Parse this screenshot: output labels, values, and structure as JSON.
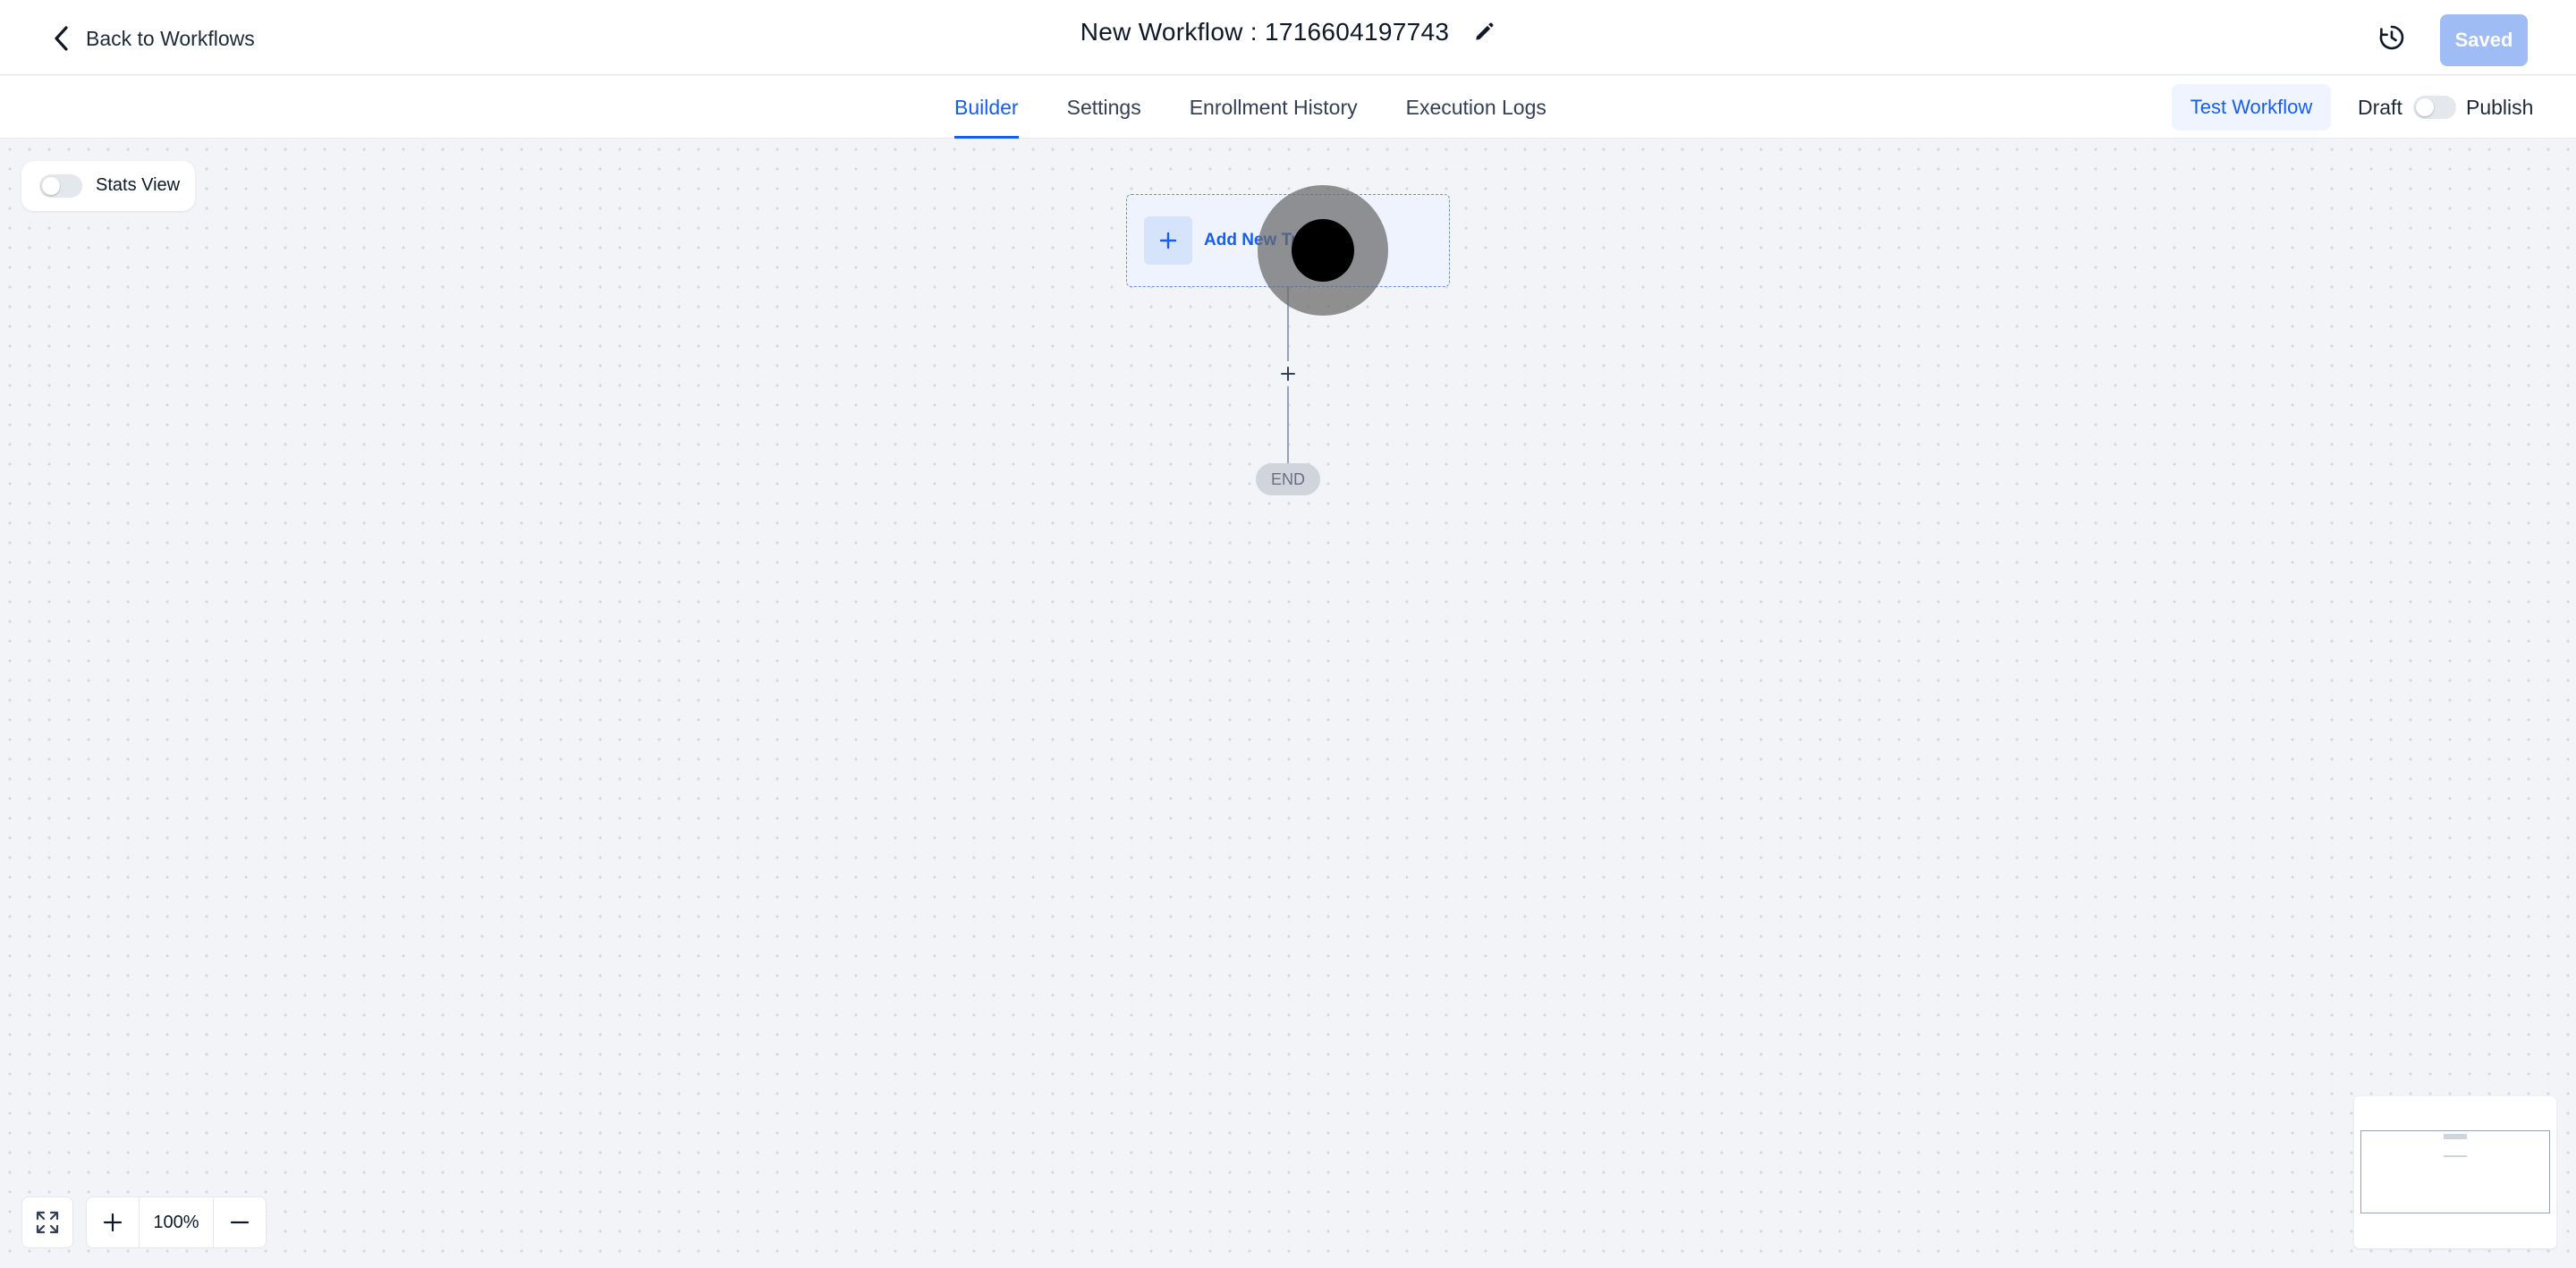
{
  "header": {
    "back_label": "Back to Workflows",
    "title": "New Workflow : 1716604197743",
    "saved_label": "Saved"
  },
  "tabs": [
    {
      "label": "Builder",
      "active": true
    },
    {
      "label": "Settings",
      "active": false
    },
    {
      "label": "Enrollment History",
      "active": false
    },
    {
      "label": "Execution Logs",
      "active": false
    }
  ],
  "actions": {
    "test_label": "Test Workflow",
    "draft_label": "Draft",
    "publish_label": "Publish",
    "published": false
  },
  "canvas": {
    "stats_view_label": "Stats View",
    "stats_view_on": false,
    "trigger_label": "Add New Trigger",
    "end_label": "END"
  },
  "zoom": {
    "level": "100%"
  },
  "icons": {
    "back": "chevron-left-icon",
    "edit": "pencil-icon",
    "history": "history-icon",
    "add": "plus-icon",
    "fit": "expand-icon",
    "zoom_in": "plus-icon",
    "zoom_out": "minus-icon"
  },
  "colors": {
    "accent": "#155eef",
    "saved_button": "#9fbcf5",
    "canvas_bg": "#f3f4f8",
    "trigger_bg": "#eef3fd"
  }
}
